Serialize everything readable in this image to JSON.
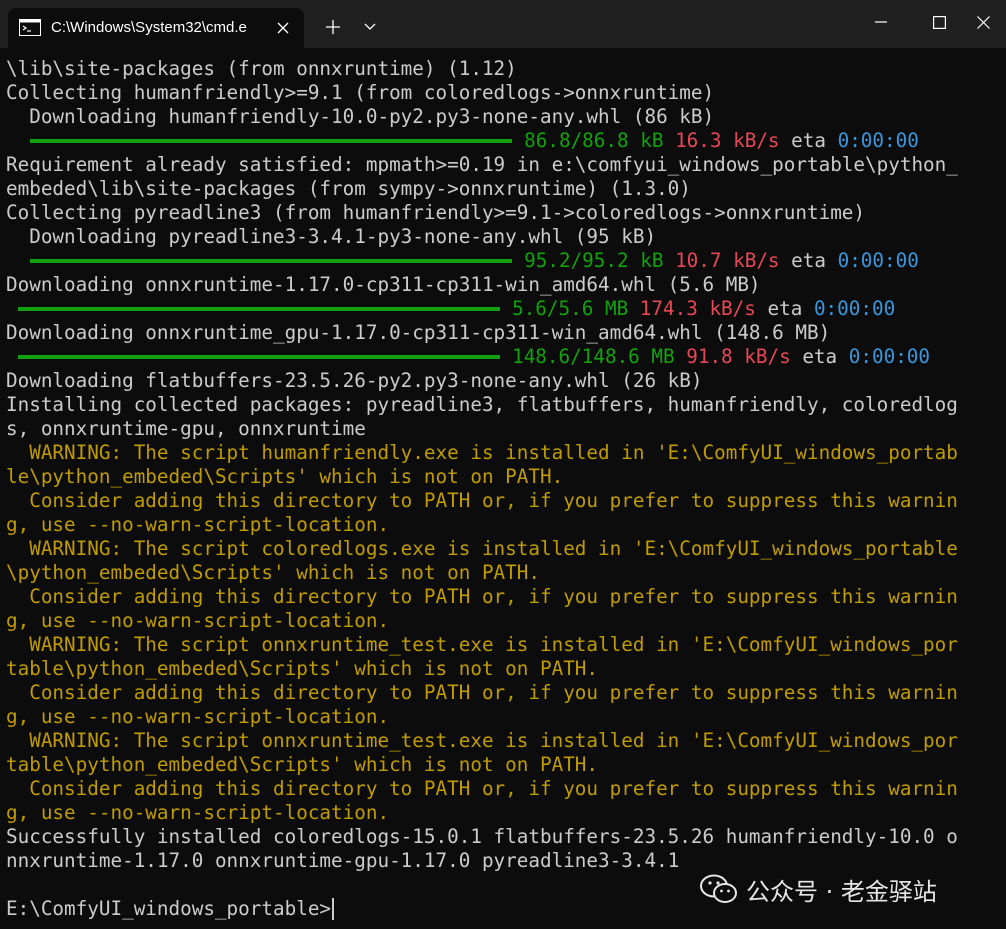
{
  "window": {
    "tab_title": "C:\\Windows\\System32\\cmd.e",
    "tab_icon": "terminal-icon",
    "new_tab_label": "+",
    "dropdown_icon": "chevron-down-icon"
  },
  "colors": {
    "background": "#0c0c0c",
    "text": "#cccccc",
    "warning": "#c19c00",
    "progress_green": "#13a10e",
    "speed_red": "#e74856",
    "eta_blue": "#3a96dd"
  },
  "terminal": {
    "lines": [
      "\\lib\\site-packages (from onnxruntime) (1.12)",
      "Collecting humanfriendly>=9.1 (from coloredlogs->onnxruntime)",
      "  Downloading humanfriendly-10.0-py2.py3-none-any.whl (86 kB)",
      "",
      "Requirement already satisfied: mpmath>=0.19 in e:\\comfyui_windows_portable\\python_",
      "embeded\\lib\\site-packages (from sympy->onnxruntime) (1.3.0)",
      "Collecting pyreadline3 (from humanfriendly>=9.1->coloredlogs->onnxruntime)",
      "  Downloading pyreadline3-3.4.1-py3-none-any.whl (95 kB)",
      "",
      "Downloading onnxruntime-1.17.0-cp311-cp311-win_amd64.whl (5.6 MB)",
      "",
      "Downloading onnxruntime_gpu-1.17.0-cp311-cp311-win_amd64.whl (148.6 MB)",
      "",
      "Downloading flatbuffers-23.5.26-py2.py3-none-any.whl (26 kB)",
      "Installing collected packages: pyreadline3, flatbuffers, humanfriendly, coloredlog",
      "s, onnxruntime-gpu, onnxruntime",
      "  WARNING: The script humanfriendly.exe is installed in 'E:\\ComfyUI_windows_portab",
      "le\\python_embeded\\Scripts' which is not on PATH.",
      "  Consider adding this directory to PATH or, if you prefer to suppress this warnin",
      "g, use --no-warn-script-location.",
      "  WARNING: The script coloredlogs.exe is installed in 'E:\\ComfyUI_windows_portable",
      "\\python_embeded\\Scripts' which is not on PATH.",
      "  Consider adding this directory to PATH or, if you prefer to suppress this warnin",
      "g, use --no-warn-script-location.",
      "  WARNING: The script onnxruntime_test.exe is installed in 'E:\\ComfyUI_windows_por",
      "table\\python_embeded\\Scripts' which is not on PATH.",
      "  Consider adding this directory to PATH or, if you prefer to suppress this warnin",
      "g, use --no-warn-script-location.",
      "  WARNING: The script onnxruntime_test.exe is installed in 'E:\\ComfyUI_windows_por",
      "table\\python_embeded\\Scripts' which is not on PATH.",
      "  Consider adding this directory to PATH or, if you prefer to suppress this warnin",
      "g, use --no-warn-script-location.",
      "Successfully installed coloredlogs-15.0.1 flatbuffers-23.5.26 humanfriendly-10.0 o",
      "nnxruntime-1.17.0 onnxruntime-gpu-1.17.0 pyreadline3-3.4.1",
      "",
      "E:\\ComfyUI_windows_portable>"
    ],
    "warning_lines": [
      16,
      17,
      18,
      19,
      20,
      21,
      22,
      23,
      24,
      25,
      26,
      27,
      28,
      29,
      30,
      31
    ],
    "progress": [
      {
        "line": 3,
        "indent": 2,
        "done": "86.8/86.8 kB",
        "speed": "16.3 kB/s",
        "eta_label": "eta",
        "eta": "0:00:00",
        "fraction": 1.0
      },
      {
        "line": 8,
        "indent": 2,
        "done": "95.2/95.2 kB",
        "speed": "10.7 kB/s",
        "eta_label": "eta",
        "eta": "0:00:00",
        "fraction": 1.0
      },
      {
        "line": 10,
        "indent": 1,
        "done": "5.6/5.6 MB",
        "speed": "174.3 kB/s",
        "eta_label": "eta",
        "eta": "0:00:00",
        "fraction": 1.0
      },
      {
        "line": 12,
        "indent": 1,
        "done": "148.6/148.6 MB",
        "speed": "91.8 kB/s",
        "eta_label": "eta",
        "eta": "0:00:00",
        "fraction": 1.0
      }
    ]
  },
  "watermark": {
    "logo": "wechat-icon",
    "text": "公众号 · 老金驿站"
  }
}
